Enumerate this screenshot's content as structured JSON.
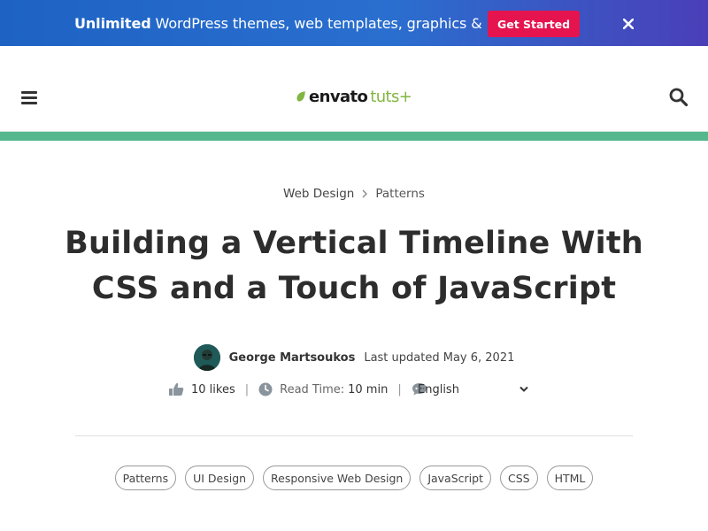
{
  "promo": {
    "strong": "Unlimited",
    "text": " WordPress themes, web templates, graphics & more!",
    "cta": "Get Started"
  },
  "logo": {
    "envato": "envato",
    "tuts": "tuts+"
  },
  "breadcrumb": [
    {
      "label": "Web Design"
    },
    {
      "label": "Patterns"
    }
  ],
  "article": {
    "title_line1": "Building a Vertical Timeline With",
    "title_line2": "CSS and a Touch of JavaScript",
    "author": "George Martsoukos",
    "updated": "Last updated May 6, 2021",
    "likes": "10 likes",
    "read_time_label": "Read Time:",
    "read_time_value": "10 min",
    "language": "English"
  },
  "tags": [
    "Patterns",
    "UI Design",
    "Responsive Web Design",
    "JavaScript",
    "CSS",
    "HTML"
  ],
  "colors": {
    "banner": "#2a6fcf",
    "cta": "#e5144f",
    "accent_bar": "#55b78e",
    "logo_green": "#82b541"
  }
}
